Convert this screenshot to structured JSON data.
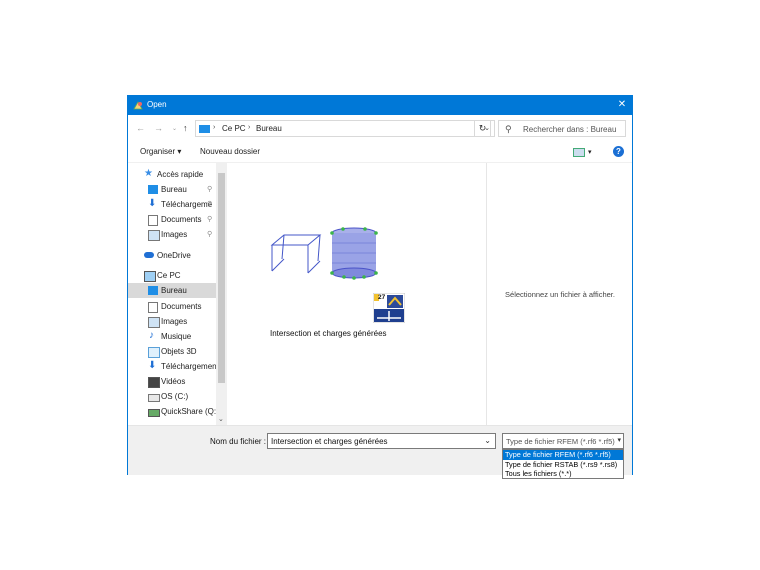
{
  "window": {
    "title": "Open"
  },
  "address": {
    "root": "Ce PC",
    "folder": "Bureau"
  },
  "search": {
    "placeholder": "Rechercher dans : Bureau"
  },
  "toolbar": {
    "organize": "Organiser",
    "new_folder": "Nouveau dossier"
  },
  "nav": {
    "items": [
      {
        "label": "Accès rapide"
      },
      {
        "label": "Bureau"
      },
      {
        "label": "Téléchargeme"
      },
      {
        "label": "Documents"
      },
      {
        "label": "Images"
      },
      {
        "label": "OneDrive"
      },
      {
        "label": "Ce PC"
      },
      {
        "label": "Bureau"
      },
      {
        "label": "Documents"
      },
      {
        "label": "Images"
      },
      {
        "label": "Musique"
      },
      {
        "label": "Objets 3D"
      },
      {
        "label": "Téléchargements"
      },
      {
        "label": "Vidéos"
      },
      {
        "label": "OS (C:)"
      },
      {
        "label": "QuickShare (Q:)"
      }
    ]
  },
  "file": {
    "name": "Intersection et charges générées",
    "badge_number": "27"
  },
  "preview": {
    "message": "Sélectionnez un fichier à afficher."
  },
  "bottom": {
    "filename_label": "Nom du fichier :",
    "filename_value": "Intersection et charges générées",
    "filetype_value": "Type de fichier RFEM (*.rf6 *.rf5)",
    "filetype_options": [
      "Type de fichier RFEM (*.rf6 *.rf5)",
      "Type de fichier RSTAB (*.rs9 *.rs8)",
      "Tous les fichiers (*.*)"
    ]
  }
}
